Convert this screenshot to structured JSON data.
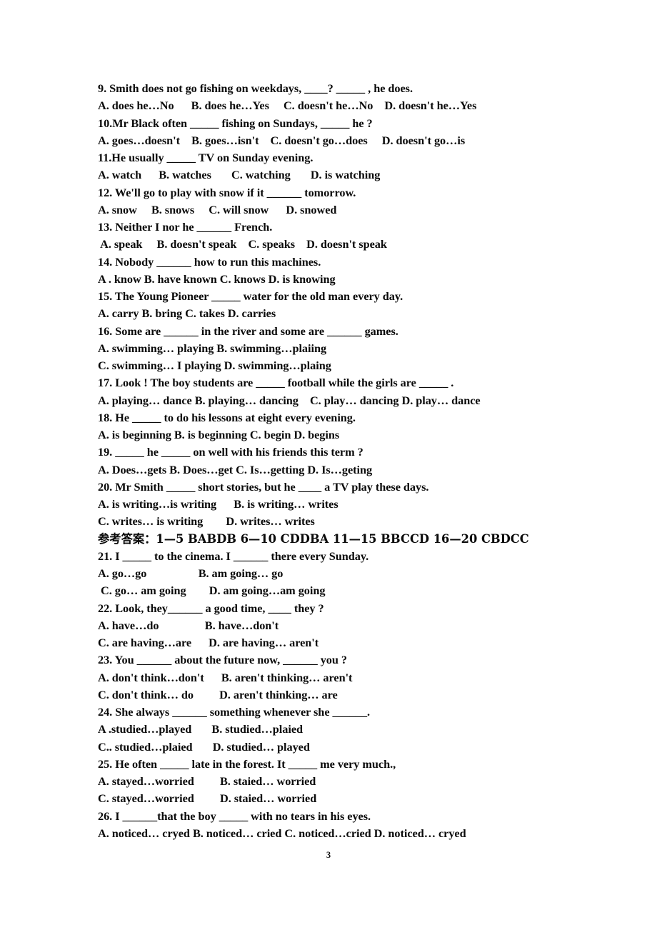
{
  "document": {
    "page_number": "3",
    "lines": [
      {
        "id": "q9-stem",
        "text": "9. Smith does not go fishing on weekdays, ____? _____ , he does."
      },
      {
        "id": "q9-options",
        "text": "A. does he…No      B. does he…Yes     C. doesn't he…No    D. doesn't he…Yes"
      },
      {
        "id": "q10-stem",
        "text": "10.Mr Black often _____ fishing on Sundays, _____ he ?"
      },
      {
        "id": "q10-options",
        "text": "A. goes…doesn't    B. goes…isn't    C. doesn't go…does     D. doesn't go…is"
      },
      {
        "id": "q11-stem",
        "text": "11.He usually _____ TV on Sunday evening."
      },
      {
        "id": "q11-options",
        "text": "A. watch      B. watches       C. watching       D. is watching"
      },
      {
        "id": "q12-stem",
        "text": "12. We'll go to play with snow if it ______ tomorrow."
      },
      {
        "id": "q12-options",
        "text": "A. snow     B. snows     C. will snow      D. snowed"
      },
      {
        "id": "q13-stem",
        "text": "13. Neither I nor he ______ French."
      },
      {
        "id": "q13-options",
        "text": " A. speak     B. doesn't speak    C. speaks    D. doesn't speak"
      },
      {
        "id": "q14-stem",
        "text": "14. Nobody ______ how to run this machines."
      },
      {
        "id": "q14-options",
        "text": "A . know B. have known C. knows D. is knowing"
      },
      {
        "id": "q15-stem",
        "text": "15. The Young Pioneer _____ water for the old man every day."
      },
      {
        "id": "q15-options",
        "text": "A. carry B. bring C. takes D. carries"
      },
      {
        "id": "q16-stem",
        "text": "16. Some are ______ in the river and some are ______ games."
      },
      {
        "id": "q16-options-ab",
        "text": "A. swimming… playing B. swimming…plaiing"
      },
      {
        "id": "q16-options-cd",
        "text": "C. swimming… I playing D. swimming…plaing"
      },
      {
        "id": "q17-stem",
        "text": "17. Look ! The boy students are _____ football while the girls are _____ ."
      },
      {
        "id": "q17-options",
        "text": "A. playing… dance B. playing… dancing    C. play… dancing D. play… dance"
      },
      {
        "id": "q18-stem",
        "text": "18. He _____ to do his lessons at eight every evening."
      },
      {
        "id": "q18-options",
        "text": "A. is beginning B. is beginning C. begin D. begins"
      },
      {
        "id": "q19-stem",
        "text": "19. _____ he _____ on well with his friends this term ?"
      },
      {
        "id": "q19-options",
        "text": "A. Does…gets B. Does…get C. Is…getting D. Is…geting"
      },
      {
        "id": "q20-stem",
        "text": "20. Mr Smith _____ short stories, but he ____ a TV play these days."
      },
      {
        "id": "q20-options-ab",
        "text": "A. is writing…is writing      B. is writing… writes"
      },
      {
        "id": "q20-options-cd",
        "text": "C. writes… is writing        D. writes… writes"
      },
      {
        "id": "answer-key",
        "text": "参考答案：1—5 BABDB 6—10 CDDBA 11—15 BBCCD 16—20 CBDCC",
        "cjk": true
      },
      {
        "id": "q21-stem",
        "text": "21. I _____ to the cinema. I ______ there every Sunday."
      },
      {
        "id": "q21-options-ab",
        "text": "A. go…go                  B. am going… go"
      },
      {
        "id": "q21-options-cd",
        "text": " C. go… am going        D. am going…am going"
      },
      {
        "id": "q22-stem",
        "text": "22. Look, they______ a good time, ____ they ?"
      },
      {
        "id": "q22-options-ab",
        "text": "A. have…do                B. have…don't"
      },
      {
        "id": "q22-options-cd",
        "text": "C. are having…are      D. are having… aren't"
      },
      {
        "id": "q23-stem",
        "text": "23. You ______ about the future now, ______ you ?"
      },
      {
        "id": "q23-options-ab",
        "text": "A. don't think…don't      B. aren't thinking… aren't"
      },
      {
        "id": "q23-options-cd",
        "text": "C. don't think… do         D. aren't thinking… are"
      },
      {
        "id": "q24-stem",
        "text": "24. She always ______ something whenever she ______."
      },
      {
        "id": "q24-options-ab",
        "text": "A .studied…played       B. studied…plaied"
      },
      {
        "id": "q24-options-cd",
        "text": "C.. studied…plaied       D. studied… played"
      },
      {
        "id": "q25-stem",
        "text": "25. He often _____ late in the forest. It _____ me very much.,"
      },
      {
        "id": "q25-options-ab",
        "text": "A. stayed…worried         B. staied… worried"
      },
      {
        "id": "q25-options-cd",
        "text": "C. stayed…worried         D. staied… worried"
      },
      {
        "id": "q26-stem",
        "text": "26. I ______that the boy _____ with no tears in his eyes."
      },
      {
        "id": "q26-options",
        "text": "A. noticed… cryed B. noticed… cried C. noticed…cried D. noticed… cryed"
      }
    ]
  }
}
